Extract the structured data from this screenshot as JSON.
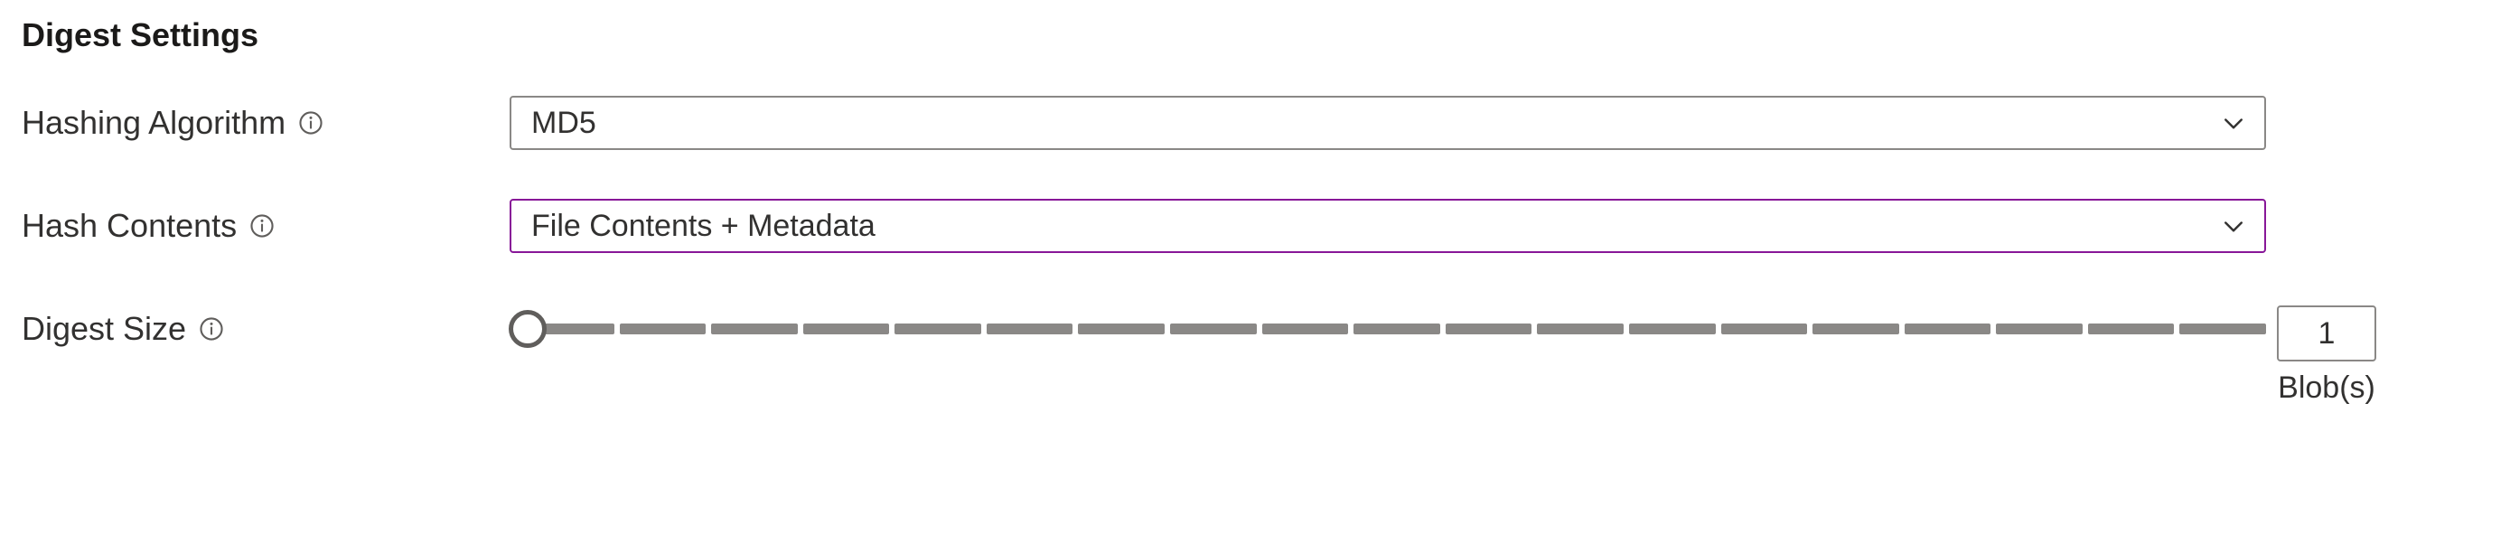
{
  "section": {
    "title": "Digest Settings"
  },
  "hashing_algorithm": {
    "label": "Hashing Algorithm",
    "value": "MD5"
  },
  "hash_contents": {
    "label": "Hash Contents",
    "value": "File Contents + Metadata"
  },
  "digest_size": {
    "label": "Digest Size",
    "value": "1",
    "unit": "Blob(s)"
  }
}
